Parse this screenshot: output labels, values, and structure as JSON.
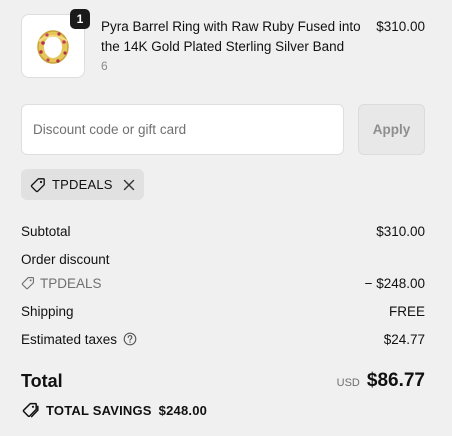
{
  "product": {
    "quantity": "1",
    "name": "Pyra Barrel Ring with Raw Ruby Fused into the 14K Gold Plated Sterling Silver Band",
    "variant": "6",
    "price": "$310.00"
  },
  "discount": {
    "placeholder": "Discount code or gift card",
    "value": "",
    "apply_label": "Apply",
    "applied_code": "TPDEALS"
  },
  "summary": {
    "subtotal_label": "Subtotal",
    "subtotal_value": "$310.00",
    "order_discount_label": "Order discount",
    "order_discount_code": "TPDEALS",
    "order_discount_value": "− $248.00",
    "shipping_label": "Shipping",
    "shipping_value": "FREE",
    "taxes_label": "Estimated taxes",
    "taxes_value": "$24.77",
    "total_label": "Total",
    "currency": "USD",
    "total_value": "$86.77",
    "savings_label": "TOTAL SAVINGS",
    "savings_value": "$248.00"
  },
  "icons": {
    "tag": "tag-icon",
    "remove": "close-icon",
    "help": "question-circle-icon",
    "savings": "tags-icon"
  }
}
